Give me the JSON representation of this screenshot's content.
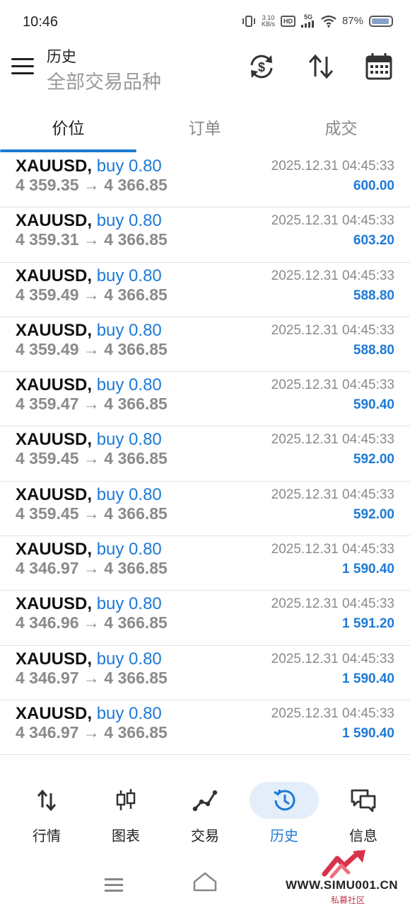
{
  "status_bar": {
    "time": "10:46",
    "net_speed_value": "3.10",
    "net_speed_unit": "KB/s",
    "hd_badge": "HD",
    "network": "5G",
    "battery": "87%"
  },
  "header": {
    "title": "历史",
    "subtitle": "全部交易品种"
  },
  "tabs": [
    {
      "label": "价位",
      "active": true
    },
    {
      "label": "订单",
      "active": false
    },
    {
      "label": "成交",
      "active": false
    }
  ],
  "deals": [
    {
      "symbol": "XAUUSD,",
      "type": "buy 0.80",
      "prices": "4 359.35 → 4 366.85",
      "time": "2025.12.31 04:45:33",
      "profit": "600.00"
    },
    {
      "symbol": "XAUUSD,",
      "type": "buy 0.80",
      "prices": "4 359.31 → 4 366.85",
      "time": "2025.12.31 04:45:33",
      "profit": "603.20"
    },
    {
      "symbol": "XAUUSD,",
      "type": "buy 0.80",
      "prices": "4 359.49 → 4 366.85",
      "time": "2025.12.31 04:45:33",
      "profit": "588.80"
    },
    {
      "symbol": "XAUUSD,",
      "type": "buy 0.80",
      "prices": "4 359.49 → 4 366.85",
      "time": "2025.12.31 04:45:33",
      "profit": "588.80"
    },
    {
      "symbol": "XAUUSD,",
      "type": "buy 0.80",
      "prices": "4 359.47 → 4 366.85",
      "time": "2025.12.31 04:45:33",
      "profit": "590.40"
    },
    {
      "symbol": "XAUUSD,",
      "type": "buy 0.80",
      "prices": "4 359.45 → 4 366.85",
      "time": "2025.12.31 04:45:33",
      "profit": "592.00"
    },
    {
      "symbol": "XAUUSD,",
      "type": "buy 0.80",
      "prices": "4 359.45 → 4 366.85",
      "time": "2025.12.31 04:45:33",
      "profit": "592.00"
    },
    {
      "symbol": "XAUUSD,",
      "type": "buy 0.80",
      "prices": "4 346.97 → 4 366.85",
      "time": "2025.12.31 04:45:33",
      "profit": "1 590.40"
    },
    {
      "symbol": "XAUUSD,",
      "type": "buy 0.80",
      "prices": "4 346.96 → 4 366.85",
      "time": "2025.12.31 04:45:33",
      "profit": "1 591.20"
    },
    {
      "symbol": "XAUUSD,",
      "type": "buy 0.80",
      "prices": "4 346.97 → 4 366.85",
      "time": "2025.12.31 04:45:33",
      "profit": "1 590.40"
    },
    {
      "symbol": "XAUUSD,",
      "type": "buy 0.80",
      "prices": "4 346.97 → 4 366.85",
      "time": "2025.12.31 04:45:33",
      "profit": "1 590.40"
    }
  ],
  "bottom_nav": [
    {
      "label": "行情",
      "icon": "quotes-arrows-icon",
      "active": false
    },
    {
      "label": "图表",
      "icon": "candlestick-icon",
      "active": false
    },
    {
      "label": "交易",
      "icon": "trade-line-icon",
      "active": false
    },
    {
      "label": "历史",
      "icon": "history-clock-icon",
      "active": true
    },
    {
      "label": "信息",
      "icon": "messages-icon",
      "active": false
    }
  ],
  "watermark": {
    "url": "WWW.SIMU001.CN",
    "sub": "私募社区"
  },
  "colors": {
    "accent": "#1e7ad6",
    "muted": "#8a8a8a",
    "text": "#222222"
  }
}
